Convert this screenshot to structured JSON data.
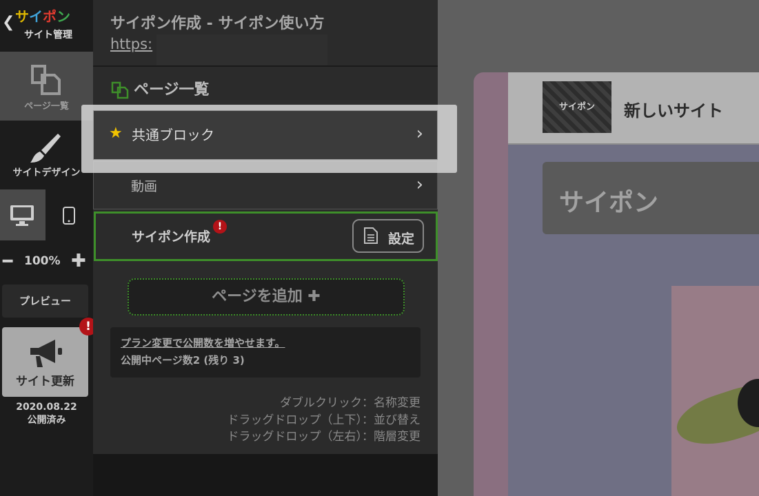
{
  "rail": {
    "brand": [
      "サ",
      "イ",
      "ポ",
      "ン"
    ],
    "brand_sub": "サイト管理",
    "pages_label": "ページ一覧",
    "design_label": "サイトデザイン",
    "zoom_value": "100%",
    "preview_label": "プレビュー",
    "update_label": "サイト更新",
    "update_badge": "!",
    "date": "2020.08.22",
    "status": "公開済み"
  },
  "panel": {
    "site_title": "サイポン作成 - サイポン使い方",
    "site_url": "https:",
    "list_heading": "ページ一覧",
    "pages": [
      {
        "label": "共通ブロック"
      },
      {
        "label": "動画"
      },
      {
        "label": "サイポン作成"
      }
    ],
    "current_badge": "!",
    "setting_label": "設定",
    "add_page_label": "ページを追加",
    "plan_link": "プラン変更で公開数を増やせます。",
    "plan_count": "公開中ページ数2 (残り 3)",
    "hints": [
      "ダブルクリック：名称変更",
      "ドラッグドロップ（上下）：並び替え",
      "ドラッグドロップ（左右）：階層変更"
    ]
  },
  "preview": {
    "logo_text": "サイポン",
    "site_name": "新しいサイト",
    "hero_text": "サイポン"
  },
  "colors": {
    "accent_green": "#3e8f2a",
    "badge_red": "#b31318",
    "star": "#f2c300"
  }
}
